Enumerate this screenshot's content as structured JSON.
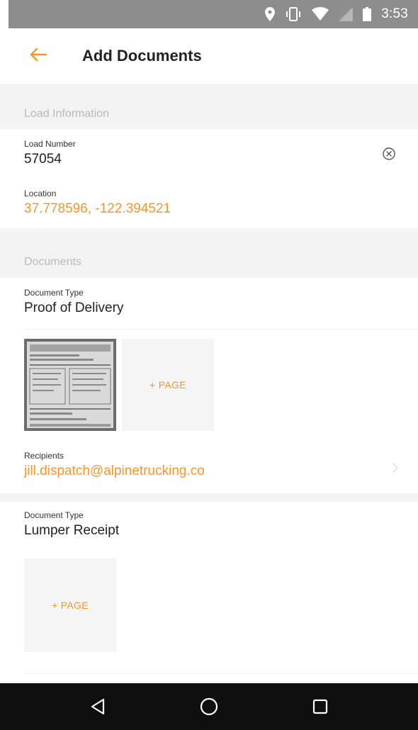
{
  "status_bar": {
    "time": "3:53",
    "icons": [
      "location-icon",
      "vibrate-icon",
      "wifi-icon",
      "signal-icon",
      "battery-icon"
    ],
    "background": "#8d8d8d"
  },
  "app_bar": {
    "title": "Add Documents",
    "back_icon": "arrow-left-icon"
  },
  "load_section": {
    "header": "Load Information",
    "load_number": {
      "label": "Load Number",
      "value": "57054"
    },
    "location": {
      "label": "Location",
      "value": "37.778596, -122.394521"
    }
  },
  "documents_section": {
    "header": "Documents",
    "documents": [
      {
        "type_label": "Document Type",
        "type_value": "Proof of Delivery",
        "add_page_label": "+ PAGE",
        "recipients_label": "Recipients",
        "recipients_value": "jill.dispatch@alpinetrucking.co"
      },
      {
        "type_label": "Document Type",
        "type_value": "Lumper Receipt",
        "add_page_label": "+ PAGE"
      }
    ]
  },
  "colors": {
    "accent": "#f2972f",
    "section_bg": "#f3f3f3",
    "section_text": "#b9b9b9",
    "nav_bg": "#0f0f0f"
  },
  "nav_bar": {
    "icons": [
      "back-triangle-icon",
      "home-circle-icon",
      "recents-square-icon"
    ]
  }
}
